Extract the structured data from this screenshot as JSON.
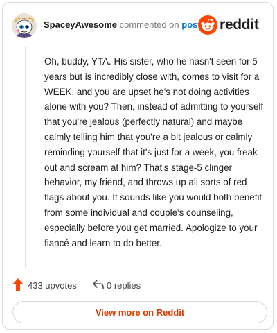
{
  "header": {
    "username": "SpaceyAwesome",
    "action_text": "commented on",
    "post_link": "post",
    "brand_name": "reddit"
  },
  "comment": {
    "body": "Oh, buddy, YTA. His sister, who he hasn't seen for 5 years but is incredibly close with, comes to visit for a WEEK, and you are upset he's not doing activities alone with you? Then, instead of admitting to yourself that you're jealous (perfectly natural) and maybe calmly telling him that you're a bit jealous or calmly reminding yourself that it's just for a week, you freak out and scream at him? That's stage-5 clinger behavior, my friend, and throws up all sorts of red flags about you. It sounds like you would both benefit from some individual and couple's counseling, especially before you get married. Apologize to your fiancé and learn to do better."
  },
  "actions": {
    "upvotes": "433 upvotes",
    "replies": "0 replies"
  },
  "cta": {
    "label": "View more on Reddit"
  },
  "icons": {
    "avatar": "avatar",
    "brand": "reddit-logo-icon",
    "upvote": "upvote-arrow-icon",
    "reply": "reply-icon"
  },
  "colors": {
    "brand": "#ff4500",
    "link": "#0079d3",
    "cta_text": "#d93a00"
  }
}
